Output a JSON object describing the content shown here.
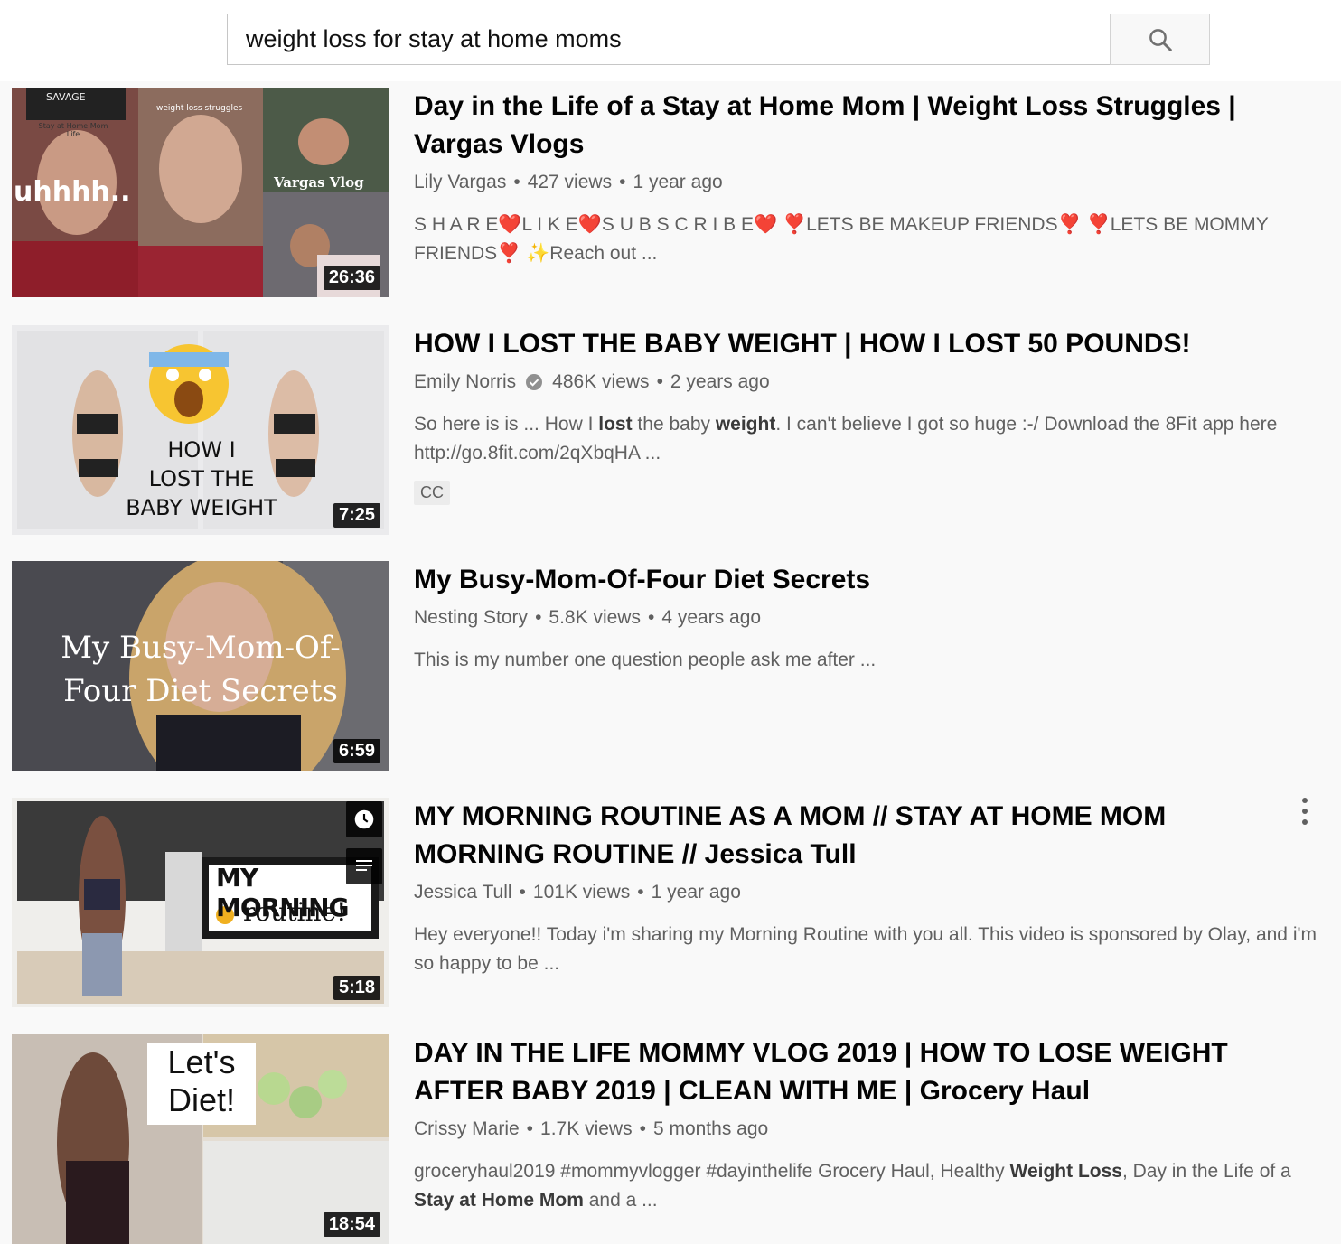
{
  "search": {
    "query": "weight loss for stay at home moms"
  },
  "icons": {
    "search": "search-icon",
    "verified": "verified-check-icon",
    "clock": "watch-later-icon",
    "queue": "add-to-queue-icon",
    "more": "more-vert-icon"
  },
  "results": [
    {
      "title": "Day in the Life of a Stay at Home Mom | Weight Loss Struggles | Vargas Vlogs",
      "channel": "Lily Vargas",
      "views": "427 views",
      "age": "1 year ago",
      "description": "S H A R E❤️L I K E❤️S U B S C R I B E❤️ ❣️LETS BE MAKEUP FRIENDS❣️ ❣️LETS BE MOMMY FRIENDS❣️ ✨Reach out ...",
      "duration": "26:36",
      "thumb_text": {
        "left": "uhhhh..",
        "cap": "SAVAGE",
        "tag": "Vargas Vlog",
        "sub": "weight loss struggles",
        "hat": "Stay at Home Mom Life"
      }
    },
    {
      "title": "HOW I LOST THE BABY WEIGHT | HOW I LOST 50 POUNDS!",
      "channel": "Emily Norris",
      "views": "486K views",
      "age": "2 years ago",
      "desc_a": "So here is is ... How I ",
      "desc_b1": "lost",
      "desc_c": " the baby ",
      "desc_b2": "weight",
      "desc_d": ". I can't believe I got so huge :-/ Download the 8Fit app here http://go.8fit.com/2qXbqHA ...",
      "badge": "CC",
      "duration": "7:25",
      "thumb_text": {
        "line1": "HOW I",
        "line2": "LOST THE",
        "line3": "BABY WEIGHT"
      }
    },
    {
      "title": "My Busy-Mom-Of-Four Diet Secrets",
      "channel": "Nesting Story",
      "views": "5.8K views",
      "age": "4 years ago",
      "description": "This is my number one question people ask me after ...",
      "duration": "6:59",
      "thumb_text": {
        "line1": "My Busy-Mom-Of-",
        "line2": "Four Diet Secrets"
      }
    },
    {
      "title": "MY MORNING ROUTINE AS A MOM // STAY AT HOME MOM MORNING ROUTINE // Jessica Tull",
      "channel": "Jessica Tull",
      "views": "101K views",
      "age": "1 year ago",
      "description": "Hey everyone!! Today i'm sharing my Morning Routine with you all. This video is sponsored by Olay, and i'm so happy to be ...",
      "duration": "5:18",
      "thumb_text": {
        "line1": "MY MORNING",
        "line2": "routine!"
      }
    },
    {
      "title": "DAY IN THE LIFE MOMMY VLOG 2019 | HOW TO LOSE WEIGHT AFTER BABY 2019 | CLEAN WITH ME | Grocery Haul",
      "channel": "Crissy Marie",
      "views": "1.7K views",
      "age": "5 months ago",
      "desc_a": "groceryhaul2019 #mommyvlogger #dayinthelife Grocery Haul, Healthy ",
      "desc_b1": "Weight Loss",
      "desc_c": ", Day in the Life of a ",
      "desc_b2": "Stay at Home Mom",
      "desc_d": " and a ...",
      "duration": "18:54",
      "thumb_text": {
        "line1": "Let's",
        "line2": "Diet!"
      }
    }
  ]
}
